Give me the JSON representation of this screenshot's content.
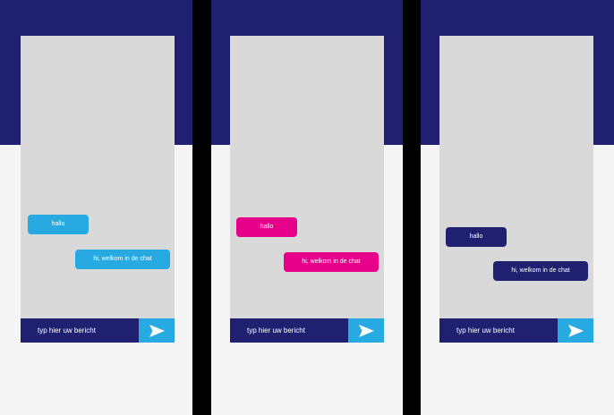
{
  "screens": [
    {
      "bubble_color": "#27a9e1",
      "messages": [
        "hallo",
        "hi, welkom in de chat"
      ],
      "input_placeholder": "typ hier uw bericht",
      "send_icon": "send-icon"
    },
    {
      "bubble_color": "#e6008a",
      "messages": [
        "hallo",
        "hi, welkom in de chat"
      ],
      "input_placeholder": "typ hier uw bericht",
      "send_icon": "send-icon"
    },
    {
      "bubble_color": "#1f2170",
      "messages": [
        "hallo",
        "hi, welkom in de chat"
      ],
      "input_placeholder": "typ hier uw bericht",
      "send_icon": "send-icon"
    }
  ],
  "colors": {
    "header": "#1f2170",
    "background": "#f5f5f5",
    "chat_area": "#d9d9d9",
    "input_bar": "#1f2170",
    "send_button": "#27a9e1"
  }
}
